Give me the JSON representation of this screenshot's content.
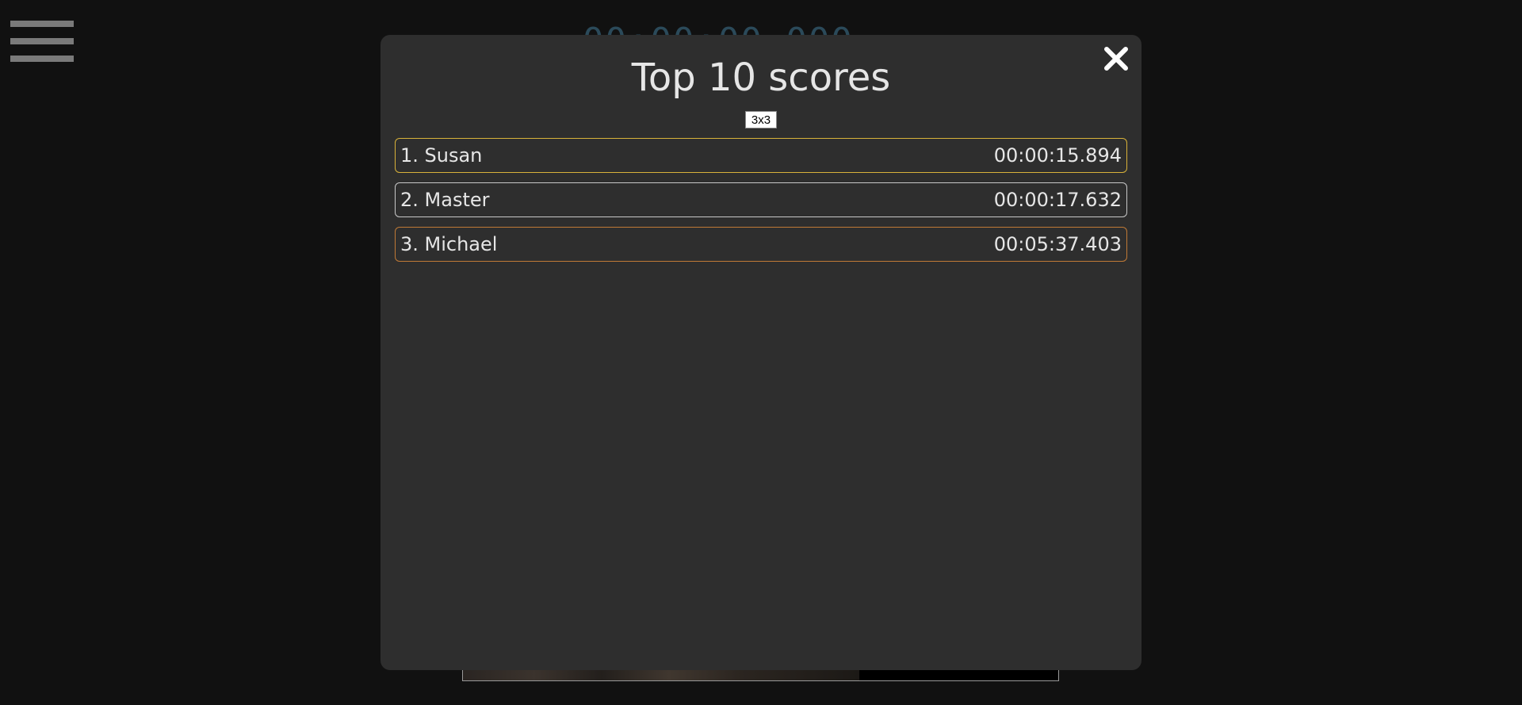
{
  "background": {
    "timer_text": "00:00:00.000"
  },
  "modal": {
    "title": "Top 10 scores",
    "size_option": "3x3",
    "scores": [
      {
        "rank_name": "1. Susan",
        "time": "00:00:15.894",
        "medal_color": "#d8b23a"
      },
      {
        "rank_name": "2. Master",
        "time": "00:00:17.632",
        "medal_color": "#c8c8c8"
      },
      {
        "rank_name": "3. Michael",
        "time": "00:05:37.403",
        "medal_color": "#c07a36"
      }
    ]
  },
  "icons": {
    "menu": "hamburger-menu-icon",
    "close": "close-icon"
  }
}
